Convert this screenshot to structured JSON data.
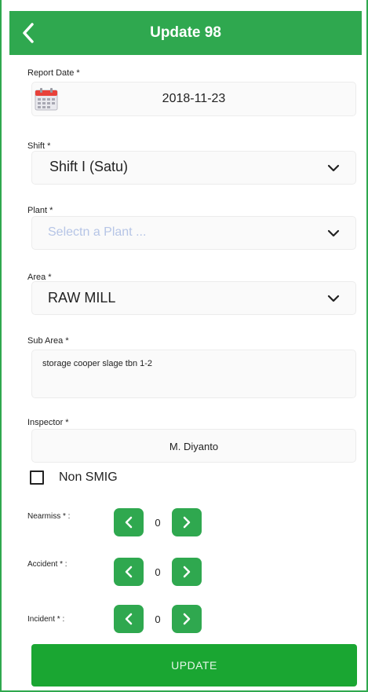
{
  "header": {
    "title": "Update 98"
  },
  "report_date": {
    "label": "Report Date *",
    "value": "2018-11-23"
  },
  "shift": {
    "label": "Shift *",
    "value": "Shift I (Satu)"
  },
  "plant": {
    "label": "Plant *",
    "placeholder": "Selectn a Plant ..."
  },
  "area": {
    "label": "Area *",
    "value": "RAW MILL"
  },
  "sub_area": {
    "label": "Sub Area *",
    "value": "storage cooper slage tbn 1-2"
  },
  "inspector": {
    "label": "Inspector *",
    "value": "M. Diyanto"
  },
  "non_smig": {
    "label": "Non SMIG",
    "checked": false
  },
  "nearmiss": {
    "label": "Nearmiss * :",
    "value": "0"
  },
  "accident": {
    "label": "Accident * :",
    "value": "0"
  },
  "incident": {
    "label": "Incident * :",
    "value": "0"
  },
  "actions": {
    "update_label": "UPDATE"
  },
  "colors": {
    "primary": "#2fa84f",
    "button": "#1aa632",
    "placeholder": "#b6c5e6"
  }
}
